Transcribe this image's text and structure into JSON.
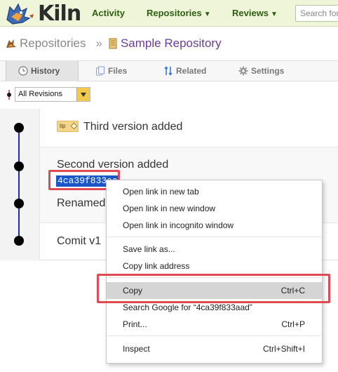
{
  "nav": {
    "logo_text": "Kiln",
    "activity": "Activity",
    "repositories": "Repositories",
    "reviews": "Reviews",
    "search_placeholder": "Search for"
  },
  "breadcrumb": {
    "root": "Repositories",
    "separator": "»",
    "current": "Sample Repository"
  },
  "tabs": [
    {
      "label": "History",
      "icon": "clock-icon",
      "active": true
    },
    {
      "label": "Files",
      "icon": "files-icon",
      "active": false
    },
    {
      "label": "Related",
      "icon": "related-icon",
      "active": false
    },
    {
      "label": "Settings",
      "icon": "gear-icon",
      "active": false
    }
  ],
  "filter": {
    "selected": "All Revisions"
  },
  "history": {
    "rows": [
      {
        "tag": "tip",
        "title": "Third version added"
      },
      {
        "title": "Second version added",
        "hash": "4ca39f833aa"
      },
      {
        "title": "Renamed"
      },
      {
        "title": "Comit v1"
      }
    ]
  },
  "context_menu": {
    "items": [
      {
        "label": "Open link in new tab",
        "shortcut": ""
      },
      {
        "label": "Open link in new window",
        "shortcut": ""
      },
      {
        "label": "Open link in incognito window",
        "shortcut": ""
      },
      {
        "label": "Save link as...",
        "shortcut": ""
      },
      {
        "label": "Copy link address",
        "shortcut": ""
      },
      {
        "label": "Copy",
        "shortcut": "Ctrl+C",
        "highlighted": true
      },
      {
        "label": "Search Google for “4ca39f833aad”",
        "shortcut": ""
      },
      {
        "label": "Print...",
        "shortcut": "Ctrl+P"
      },
      {
        "label": "Inspect",
        "shortcut": "Ctrl+Shift+I"
      }
    ]
  },
  "colors": {
    "nav_bg": "#eef5d8",
    "nav_text": "#2d5e12",
    "breadcrumb_current": "#6a3d9a",
    "timeline_line": "#1c2fa8",
    "selection": "#1a56c8",
    "annotation_box": "#e04a52",
    "tag_bg": "#f3d68a",
    "dropdown_button": "#f2c94c"
  }
}
